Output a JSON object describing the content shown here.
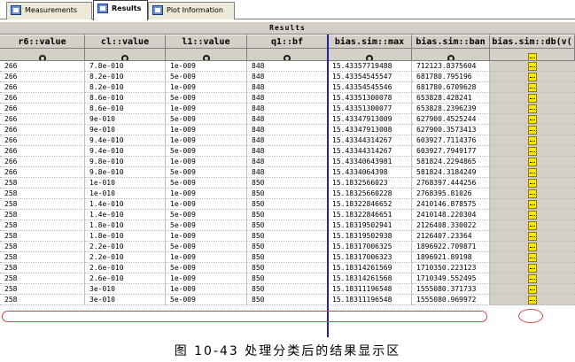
{
  "tabs": [
    {
      "label": "Measurements",
      "active": false
    },
    {
      "label": "Results",
      "active": true
    },
    {
      "label": "Plot Information",
      "active": false
    }
  ],
  "table": {
    "title": "Results",
    "columns": [
      "r6::value",
      "cl::value",
      "l1::value",
      "q1::bf",
      "bias.sim::max",
      "bias.sim::ban",
      "bias.sim::db(v("
    ],
    "rows": [
      [
        "266",
        "7.8e-010",
        "1e-009",
        "848",
        "15.43357719488",
        "712123.8375604"
      ],
      [
        "266",
        "8.2e-010",
        "5e-009",
        "848",
        "15.43354545547",
        "681780.795196"
      ],
      [
        "266",
        "8.2e-010",
        "1e-009",
        "848",
        "15.43354545546",
        "681780.6709628"
      ],
      [
        "266",
        "8.6e-010",
        "5e-009",
        "848",
        "15.43351300078",
        "653828.428241"
      ],
      [
        "266",
        "8.6e-010",
        "1e-009",
        "848",
        "15.43351300077",
        "653828.2396239"
      ],
      [
        "266",
        "9e-010",
        "5e-009",
        "848",
        "15.43347913009",
        "627900.4525244"
      ],
      [
        "266",
        "9e-010",
        "1e-009",
        "848",
        "15.43347913008",
        "627900.3573413"
      ],
      [
        "266",
        "9.4e-010",
        "1e-009",
        "848",
        "15.43344314267",
        "603927.7114376"
      ],
      [
        "266",
        "9.4e-010",
        "5e-009",
        "848",
        "15.43344314267",
        "603927.7949177"
      ],
      [
        "266",
        "9.8e-010",
        "1e-009",
        "848",
        "15.43340643981",
        "581824.2294865"
      ],
      [
        "266",
        "9.8e-010",
        "5e-009",
        "848",
        "15.4334064398",
        "581824.3184249"
      ],
      [
        "258",
        "1e-010",
        "5e-009",
        "850",
        "15.1832566023",
        "2768397.444256"
      ],
      [
        "258",
        "1e-010",
        "1e-009",
        "850",
        "15.18325660228",
        "2768395.81026"
      ],
      [
        "258",
        "1.4e-010",
        "1e-009",
        "850",
        "15.18322846652",
        "2410146.878575"
      ],
      [
        "258",
        "1.4e-010",
        "5e-009",
        "850",
        "15.18322846651",
        "2410148.220304"
      ],
      [
        "258",
        "1.8e-010",
        "5e-009",
        "850",
        "15.18319502941",
        "2126408.330022"
      ],
      [
        "258",
        "1.8e-010",
        "1e-009",
        "850",
        "15.18319502938",
        "2126407.23364"
      ],
      [
        "258",
        "2.2e-010",
        "5e-009",
        "850",
        "15.18317006325",
        "1896922.709871"
      ],
      [
        "258",
        "2.2e-010",
        "1e-009",
        "850",
        "15.18317006323",
        "1896921.89198"
      ],
      [
        "258",
        "2.6e-010",
        "5e-009",
        "850",
        "15.18314261569",
        "1710350.223123"
      ],
      [
        "258",
        "2.6e-010",
        "1e-009",
        "850",
        "15.18314261568",
        "1710349.552495"
      ],
      [
        "258",
        "3e-010",
        "1e-009",
        "850",
        "15.18311196548",
        "1555080.371733"
      ],
      [
        "258",
        "3e-010",
        "5e-009",
        "850",
        "15.18311196548",
        "1555080.969972"
      ]
    ]
  },
  "caption": "图 10-43 处理分类后的结果显示区",
  "colors": {
    "chrome": "#d4d0c8",
    "separator": "#1e1ebc",
    "highlight": "#d04848",
    "doc_icon": "#ffe800"
  }
}
